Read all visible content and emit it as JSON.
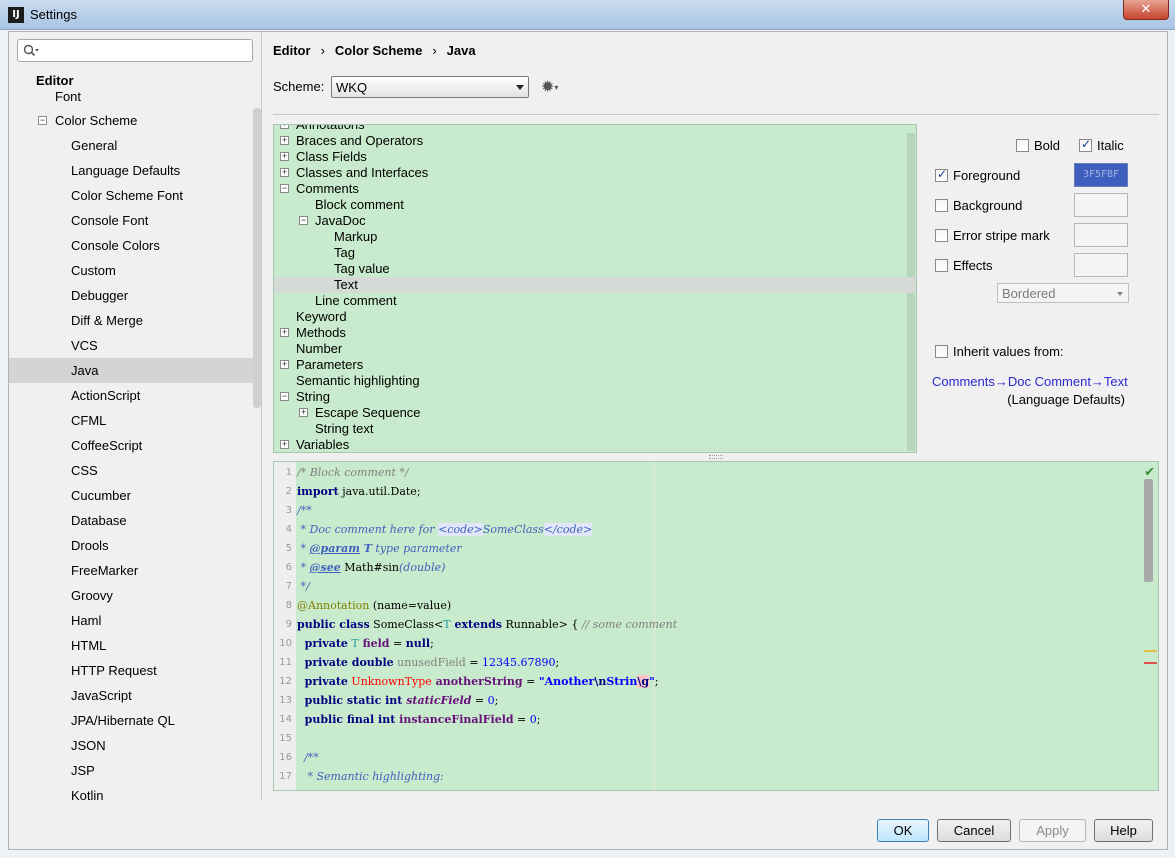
{
  "window": {
    "title": "Settings",
    "app_icon": "IJ",
    "close_glyph": "✕"
  },
  "sidebar": {
    "search_placeholder": "",
    "header": "Editor",
    "font_item": "Font",
    "color_scheme": "Color Scheme",
    "items": [
      "General",
      "Language Defaults",
      "Color Scheme Font",
      "Console Font",
      "Console Colors",
      "Custom",
      "Debugger",
      "Diff & Merge",
      "VCS",
      "Java",
      "ActionScript",
      "CFML",
      "CoffeeScript",
      "CSS",
      "Cucumber",
      "Database",
      "Drools",
      "FreeMarker",
      "Groovy",
      "Haml",
      "HTML",
      "HTTP Request",
      "JavaScript",
      "JPA/Hibernate QL",
      "JSON",
      "JSP",
      "Kotlin"
    ],
    "selected": "Java"
  },
  "breadcrumb": [
    "Editor",
    "Color Scheme",
    "Java"
  ],
  "breadcrumb_sep": "›",
  "scheme": {
    "label": "Scheme:",
    "value": "WKQ"
  },
  "gear_glyph": "✹",
  "gear_drop": "▾",
  "element_tree": [
    {
      "label": "Annotations",
      "level": 0,
      "toggle": "+"
    },
    {
      "label": "Braces and Operators",
      "level": 0,
      "toggle": "+"
    },
    {
      "label": "Class Fields",
      "level": 0,
      "toggle": "+"
    },
    {
      "label": "Classes and Interfaces",
      "level": 0,
      "toggle": "+"
    },
    {
      "label": "Comments",
      "level": 0,
      "toggle": "−"
    },
    {
      "label": "Block comment",
      "level": 1,
      "toggle": ""
    },
    {
      "label": "JavaDoc",
      "level": 1,
      "toggle": "−"
    },
    {
      "label": "Markup",
      "level": 2,
      "toggle": ""
    },
    {
      "label": "Tag",
      "level": 2,
      "toggle": ""
    },
    {
      "label": "Tag value",
      "level": 2,
      "toggle": ""
    },
    {
      "label": "Text",
      "level": 2,
      "toggle": "",
      "selected": true
    },
    {
      "label": "Line comment",
      "level": 1,
      "toggle": ""
    },
    {
      "label": "Keyword",
      "level": 0,
      "toggle": ""
    },
    {
      "label": "Methods",
      "level": 0,
      "toggle": "+"
    },
    {
      "label": "Number",
      "level": 0,
      "toggle": ""
    },
    {
      "label": "Parameters",
      "level": 0,
      "toggle": "+"
    },
    {
      "label": "Semantic highlighting",
      "level": 0,
      "toggle": ""
    },
    {
      "label": "String",
      "level": 0,
      "toggle": "−"
    },
    {
      "label": "Escape Sequence",
      "level": 1,
      "toggle": "+"
    },
    {
      "label": "String text",
      "level": 1,
      "toggle": ""
    },
    {
      "label": "Variables",
      "level": 0,
      "toggle": "+"
    }
  ],
  "attributes": {
    "bold": {
      "label": "Bold",
      "checked": false
    },
    "italic": {
      "label": "Italic",
      "checked": true
    },
    "foreground": {
      "label": "Foreground",
      "checked": true,
      "color": "3F5FBF"
    },
    "background": {
      "label": "Background",
      "checked": false
    },
    "error_stripe": {
      "label": "Error stripe mark",
      "checked": false
    },
    "effects": {
      "label": "Effects",
      "checked": false
    },
    "effects_type": "Bordered",
    "inherit": {
      "label": "Inherit values from:",
      "checked": false
    },
    "inherit_link": "Comments→Doc Comment→Text",
    "inherit_sub": "(Language Defaults)"
  },
  "colors": {
    "tree_bg": "#c9ebcd",
    "foreground_swatch": "#3f5fbf"
  },
  "code": {
    "line_numbers": [
      "1",
      "2",
      "3",
      "4",
      "5",
      "6",
      "7",
      "8",
      "9",
      "10",
      "11",
      "12",
      "13",
      "14",
      "15",
      "16",
      "17"
    ],
    "l1": "/* Block comment */",
    "l2_kw": "import",
    "l2_rest": " java.util.Date;",
    "l3": "/**",
    "l4_a": " * Doc comment here for ",
    "l4_tag_open": "<code>",
    "l4_b": "SomeClass",
    "l4_tag_close": "</code>",
    "l5_a": " * ",
    "l5_tag": "@param",
    "l5_b": " T",
    "l5_c": " type parameter",
    "l6_a": " * ",
    "l6_tag": "@see",
    "l6_b": " Math#sin",
    "l6_c": "(double)",
    "l7": " */",
    "l8_ann": "@Annotation",
    "l8_rest": " (name=value)",
    "l9_kw": "public class",
    "l9_a": " SomeClass<",
    "l9_t": "T",
    "l9_kw2": " extends",
    "l9_b": " Runnable> { ",
    "l9_cm": "// some comment",
    "l10_kw": "  private",
    "l10_t": " T",
    "l10_f": " field",
    "l10_b": " = ",
    "l10_kw2": "null",
    "l10_c": ";",
    "l11_kw": "  private double",
    "l11_u": " unusedField",
    "l11_b": " = ",
    "l11_n": "12345.67890",
    "l11_c": ";",
    "l12_kw": "  private",
    "l12_err": " UnknownType",
    "l12_f": " anotherString",
    "l12_b": " = ",
    "l12_s1": "\"Another",
    "l12_esc": "\\n",
    "l12_s2": "Strin",
    "l12_s3": "\\g",
    "l12_s4": "\"",
    "l12_c": ";",
    "l13_kw": "  public static int",
    "l13_f": " staticField",
    "l13_b": " = ",
    "l13_n": "0",
    "l13_c": ";",
    "l14_kw": "  public final int",
    "l14_f": " instanceFinalField",
    "l14_b": " = ",
    "l14_n": "0",
    "l14_c": ";",
    "l16": "  /**",
    "l17": "   * Semantic highlighting:"
  },
  "preview_check": "✔",
  "buttons": {
    "ok": "OK",
    "cancel": "Cancel",
    "apply": "Apply",
    "help": "Help"
  }
}
